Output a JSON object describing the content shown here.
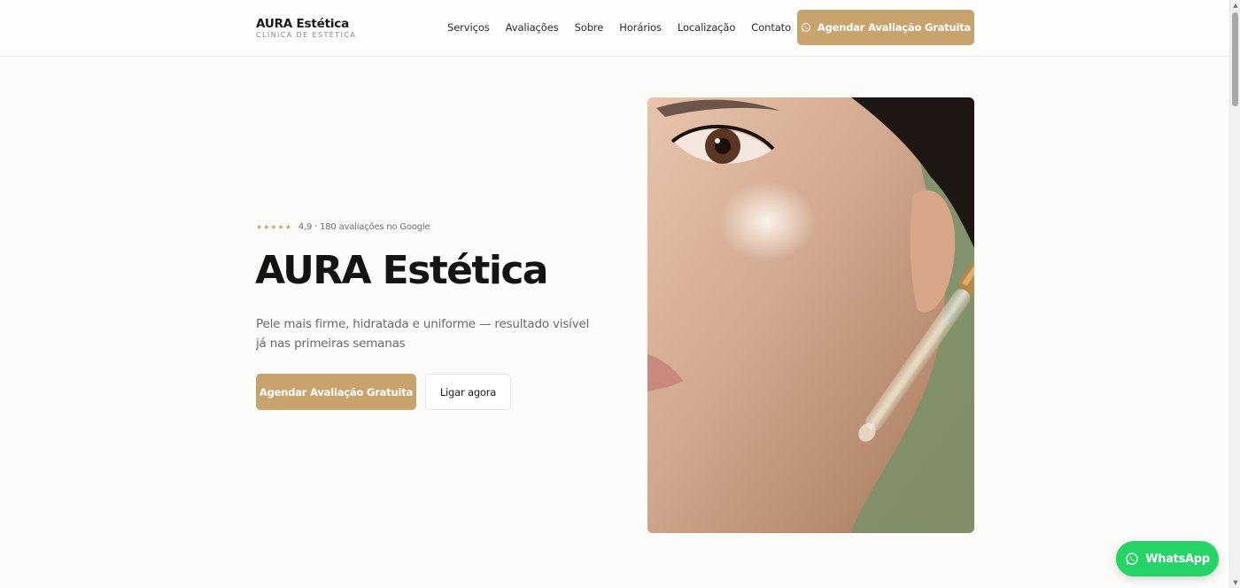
{
  "header": {
    "logo_title": "AURA Estética",
    "logo_subtitle": "CLÍNICA DE ESTÉTICA",
    "nav": [
      "Serviços",
      "Avaliações",
      "Sobre",
      "Horários",
      "Localização",
      "Contato"
    ],
    "cta_label": "Agendar Avaliação Gratuita",
    "cta_icon": "whatsapp-icon"
  },
  "hero": {
    "stars": "★★★★★",
    "rating_text": "4,9 · 180 avaliações no Google",
    "title": "AURA Estética",
    "description": "Pele mais firme, hidratada e uniforme — resultado visível já nas primeiras semanas",
    "primary_button": "Agendar Avaliação Gratuita",
    "secondary_button": "Ligar agora"
  },
  "whatsapp_float": {
    "label": "WhatsApp",
    "icon": "whatsapp-icon"
  },
  "colors": {
    "accent": "#c9a36e",
    "whatsapp": "#25d366",
    "background": "#fbfbf9"
  }
}
